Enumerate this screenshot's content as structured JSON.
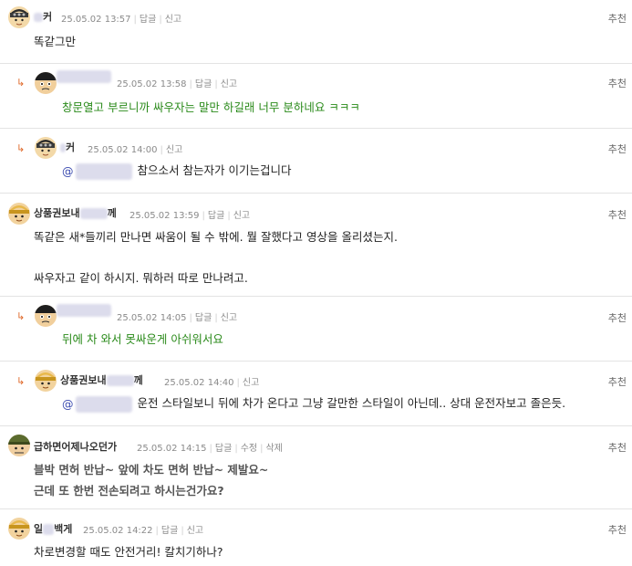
{
  "ui": {
    "reply": "답글",
    "report": "신고",
    "edit": "수정",
    "delete": "삭제",
    "recommend": "추천",
    "at": "@"
  },
  "c1": {
    "nick_suffix": "커",
    "time": "25.05.02 13:57",
    "text": "똑같그만"
  },
  "c2": {
    "time": "25.05.02 13:58",
    "text": "창문열고 부르니까 싸우자는 말만 하길래 너무 분하네요 ㅋㅋㅋ"
  },
  "c3": {
    "nick_suffix": "커",
    "time": "25.05.02 14:00",
    "text": "참으소서 참는자가 이기는겁니다"
  },
  "c4": {
    "nick_prefix": "상품권보내",
    "nick_suffix": "께",
    "time": "25.05.02 13:59",
    "line1": "똑같은 새*들끼리 만나면 싸움이 될 수 밖에. 뭘 잘했다고 영상을 올리셨는지.",
    "line2": "싸우자고 같이 하시지. 뭐하러 따로 만나려고."
  },
  "c5": {
    "time": "25.05.02 14:05",
    "text": "뒤에 차 와서 못싸운게 아쉬워서요"
  },
  "c6": {
    "nick_prefix": "상품권보내",
    "nick_suffix": "께",
    "time": "25.05.02 14:40",
    "text": "운전 스타일보니 뒤에 차가 온다고 그냥 갈만한 스타일이 아닌데.. 상대 운전자보고 졸은듯."
  },
  "c7": {
    "nick": "급하면어제나오던가",
    "time": "25.05.02 14:15",
    "line1": "블박 면허 반납~ 앞에 차도 면허 반납~ 제발요~",
    "line2": "근데 또 한번 전손되려고 하시는건가요?"
  },
  "c8": {
    "nick_prefix": "일",
    "nick_suffix": "백게",
    "time": "25.05.02 14:22",
    "text": "차로변경할 때도 안전거리! 칼치기하나?"
  },
  "colors": {
    "accent_arrow": "#e06a2b",
    "reply_text": "#2a8a1a",
    "separator": "#e3e3e3"
  }
}
